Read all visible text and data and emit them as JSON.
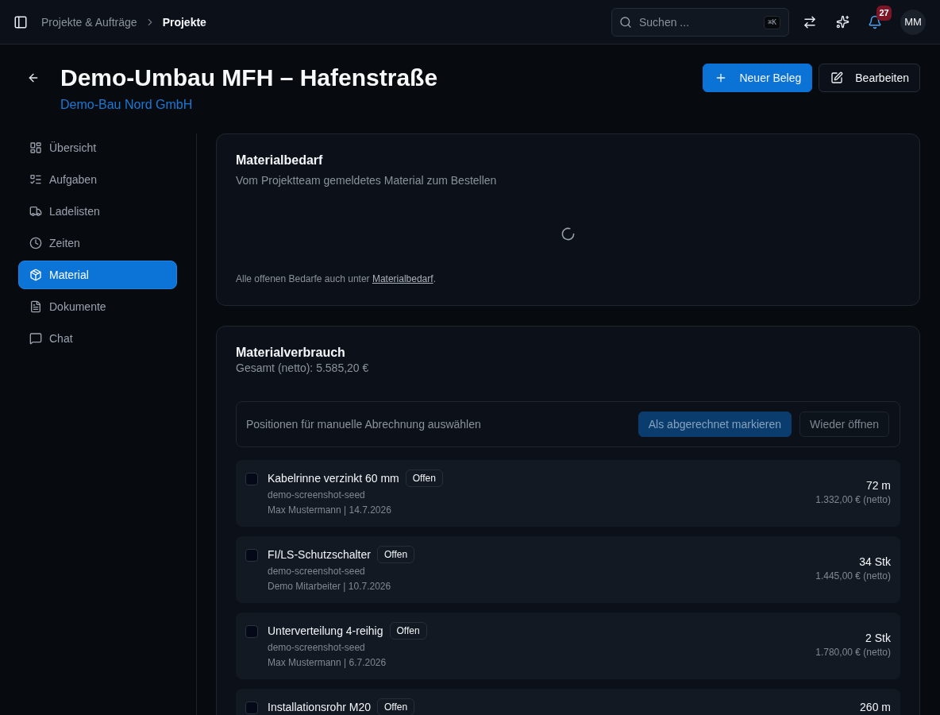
{
  "topbar": {
    "breadcrumb": [
      {
        "label": "Projekte & Aufträge",
        "current": false
      },
      {
        "label": "Projekte",
        "current": true
      }
    ],
    "search": {
      "placeholder": "Suchen ...",
      "shortcut": "⌘K"
    },
    "notifications": "27",
    "avatar": "MM"
  },
  "header": {
    "title": "Demo-Umbau MFH – Hafenstraße",
    "client": "Demo-Bau Nord GmbH",
    "buttons": [
      {
        "label": "Neuer Beleg",
        "kind": "primary"
      },
      {
        "label": "Bearbeiten",
        "kind": "secondary"
      }
    ]
  },
  "sidebar": {
    "items": [
      {
        "label": "Übersicht",
        "selected": false
      },
      {
        "label": "Aufgaben",
        "selected": false
      },
      {
        "label": "Ladelisten",
        "selected": false
      },
      {
        "label": "Zeiten",
        "selected": false
      },
      {
        "label": "Material",
        "selected": true
      },
      {
        "label": "Dokumente",
        "selected": false
      },
      {
        "label": "Chat",
        "selected": false
      }
    ]
  },
  "material_requirements": {
    "title": "Materialbedarf",
    "subtitle": "Vom Projektteam gemeldetes Material zum Bestellen",
    "loading": true,
    "note": {
      "text": "Alle offenen Bedarfe auch unter ",
      "link": "Materialbedarf",
      "end": "."
    }
  },
  "material_consumption": {
    "title": "Materialverbrauch",
    "total": "Gesamt (netto): 5.585,20 €",
    "toolbar": {
      "hint": "Positionen für manuelle Abrechnung auswählen",
      "buttons": [
        {
          "label": "Als abgerechnet markieren",
          "kind": "primary",
          "disabled": true
        },
        {
          "label": "Wieder öffnen",
          "kind": "secondary",
          "disabled": true
        }
      ]
    },
    "items": [
      {
        "name": "Kabelrinne verzinkt 60 mm",
        "status": "Offen",
        "source": "demo-screenshot-seed",
        "meta": "Max Mustermann | 14.7.2026",
        "quantity": "72 m",
        "price": "1.332,00 € (netto)",
        "checked": false
      },
      {
        "name": "FI/LS-Schutzschalter",
        "status": "Offen",
        "source": "demo-screenshot-seed",
        "meta": "Demo Mitarbeiter | 10.7.2026",
        "quantity": "34 Stk",
        "price": "1.445,00 € (netto)",
        "checked": false
      },
      {
        "name": "Unterverteilung 4-reihig",
        "status": "Offen",
        "source": "demo-screenshot-seed",
        "meta": "Max Mustermann | 6.7.2026",
        "quantity": "2 Stk",
        "price": "1.780,00 € (netto)",
        "checked": false
      },
      {
        "name": "Installationsrohr M20",
        "status": "Offen",
        "quantity": "260 m",
        "checked": false
      }
    ]
  }
}
